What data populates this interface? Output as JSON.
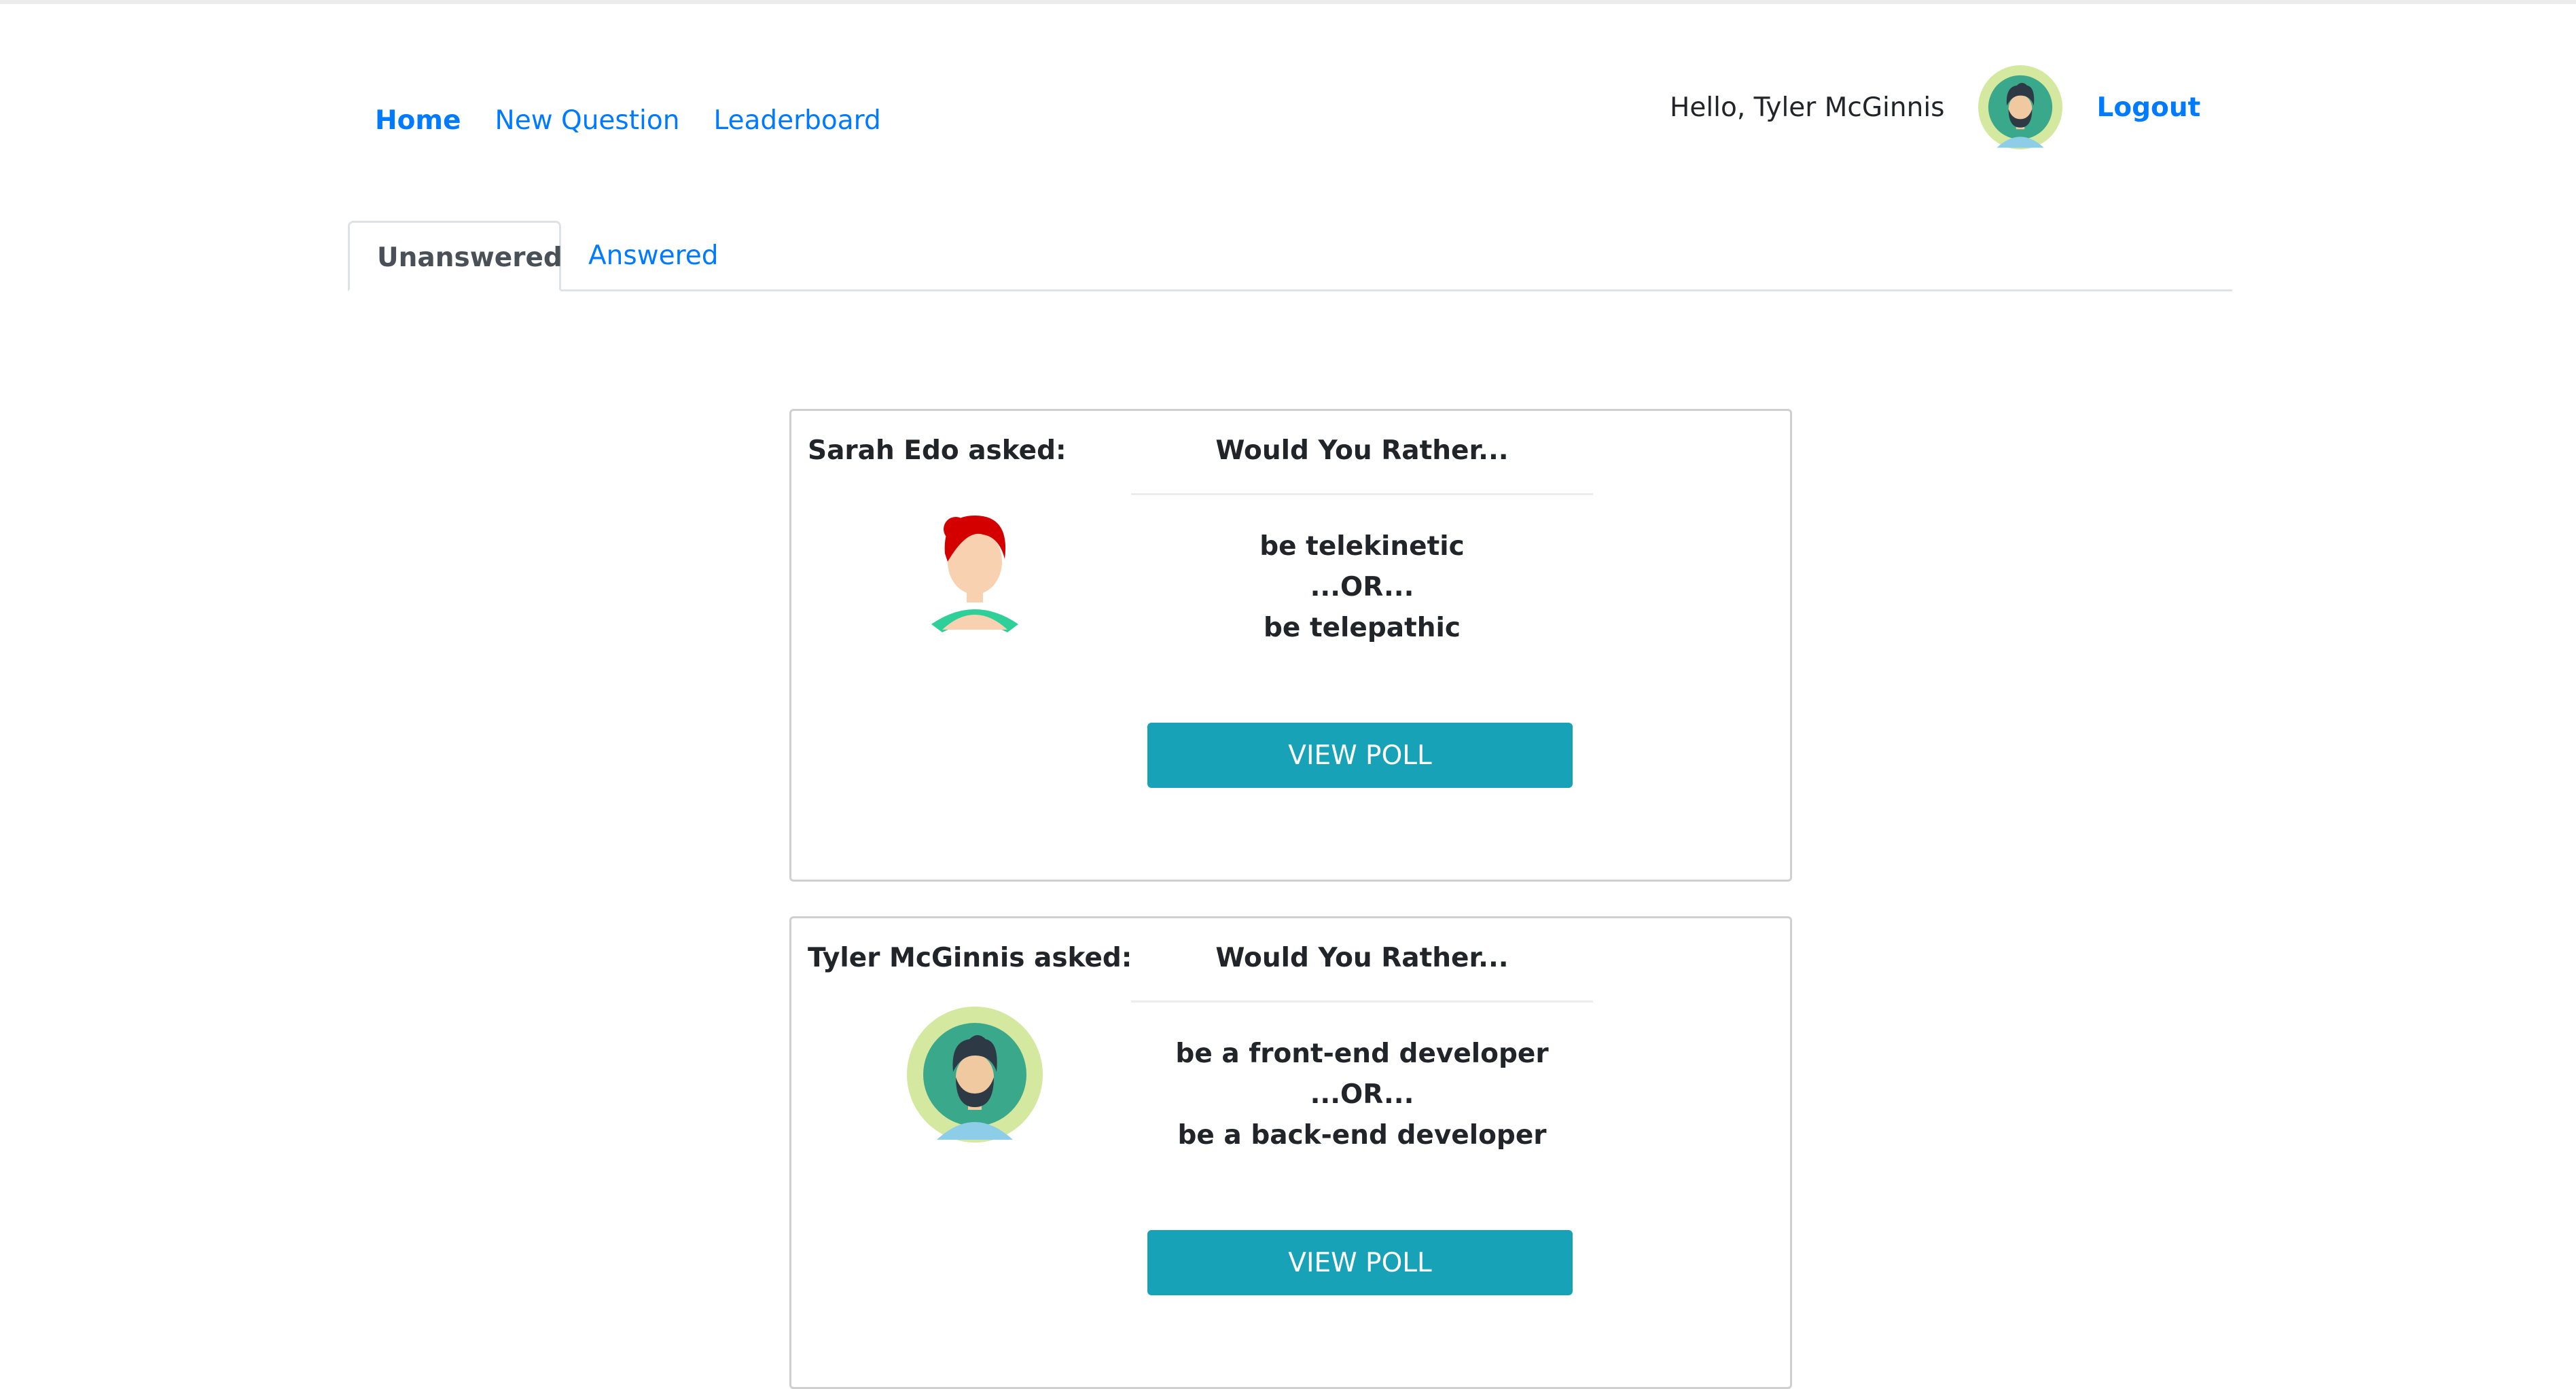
{
  "nav": {
    "home": "Home",
    "new_question": "New Question",
    "leaderboard": "Leaderboard"
  },
  "user": {
    "greeting": "Hello, Tyler McGinnis",
    "logout": "Logout",
    "avatar_icon": "bearded-man-avatar"
  },
  "tabs": {
    "unanswered": "Unanswered",
    "answered": "Answered"
  },
  "questions": [
    {
      "asker": "Sarah Edo asked:",
      "avatar_icon": "red-haired-woman-avatar",
      "heading": "Would You Rather...",
      "option_one": "be telekinetic",
      "separator": "...OR...",
      "option_two": "be telepathic",
      "button": "VIEW POLL"
    },
    {
      "asker": "Tyler McGinnis asked:",
      "avatar_icon": "bearded-man-avatar",
      "heading": "Would You Rather...",
      "option_one": "be a front-end developer",
      "separator": "...OR...",
      "option_two": "be a back-end developer",
      "button": "VIEW POLL"
    }
  ],
  "colors": {
    "link": "#007bff",
    "button": "#17a2b8",
    "avatar_ring": "#d4e8a0",
    "avatar_inner": "#3aa88a",
    "hair_red": "#d40000"
  }
}
